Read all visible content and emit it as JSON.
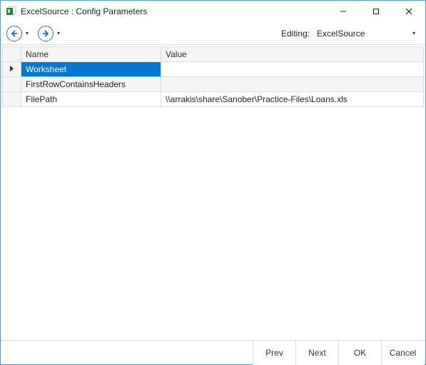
{
  "titlebar": {
    "title": "ExcelSource : Config Parameters"
  },
  "toolbar": {
    "editing_label": "Editing:",
    "editing_value": "ExcelSource"
  },
  "grid": {
    "columns": {
      "name": "Name",
      "value": "Value"
    },
    "rows": [
      {
        "name": "Worksheet",
        "value": "",
        "selected": true
      },
      {
        "name": "FirstRowContainsHeaders",
        "value": ""
      },
      {
        "name": "FilePath",
        "value": "\\\\arrakis\\share\\Sanober\\Practice-Files\\Loans.xls"
      }
    ]
  },
  "footer": {
    "prev": "Prev",
    "next": "Next",
    "ok": "OK",
    "cancel": "Cancel"
  }
}
